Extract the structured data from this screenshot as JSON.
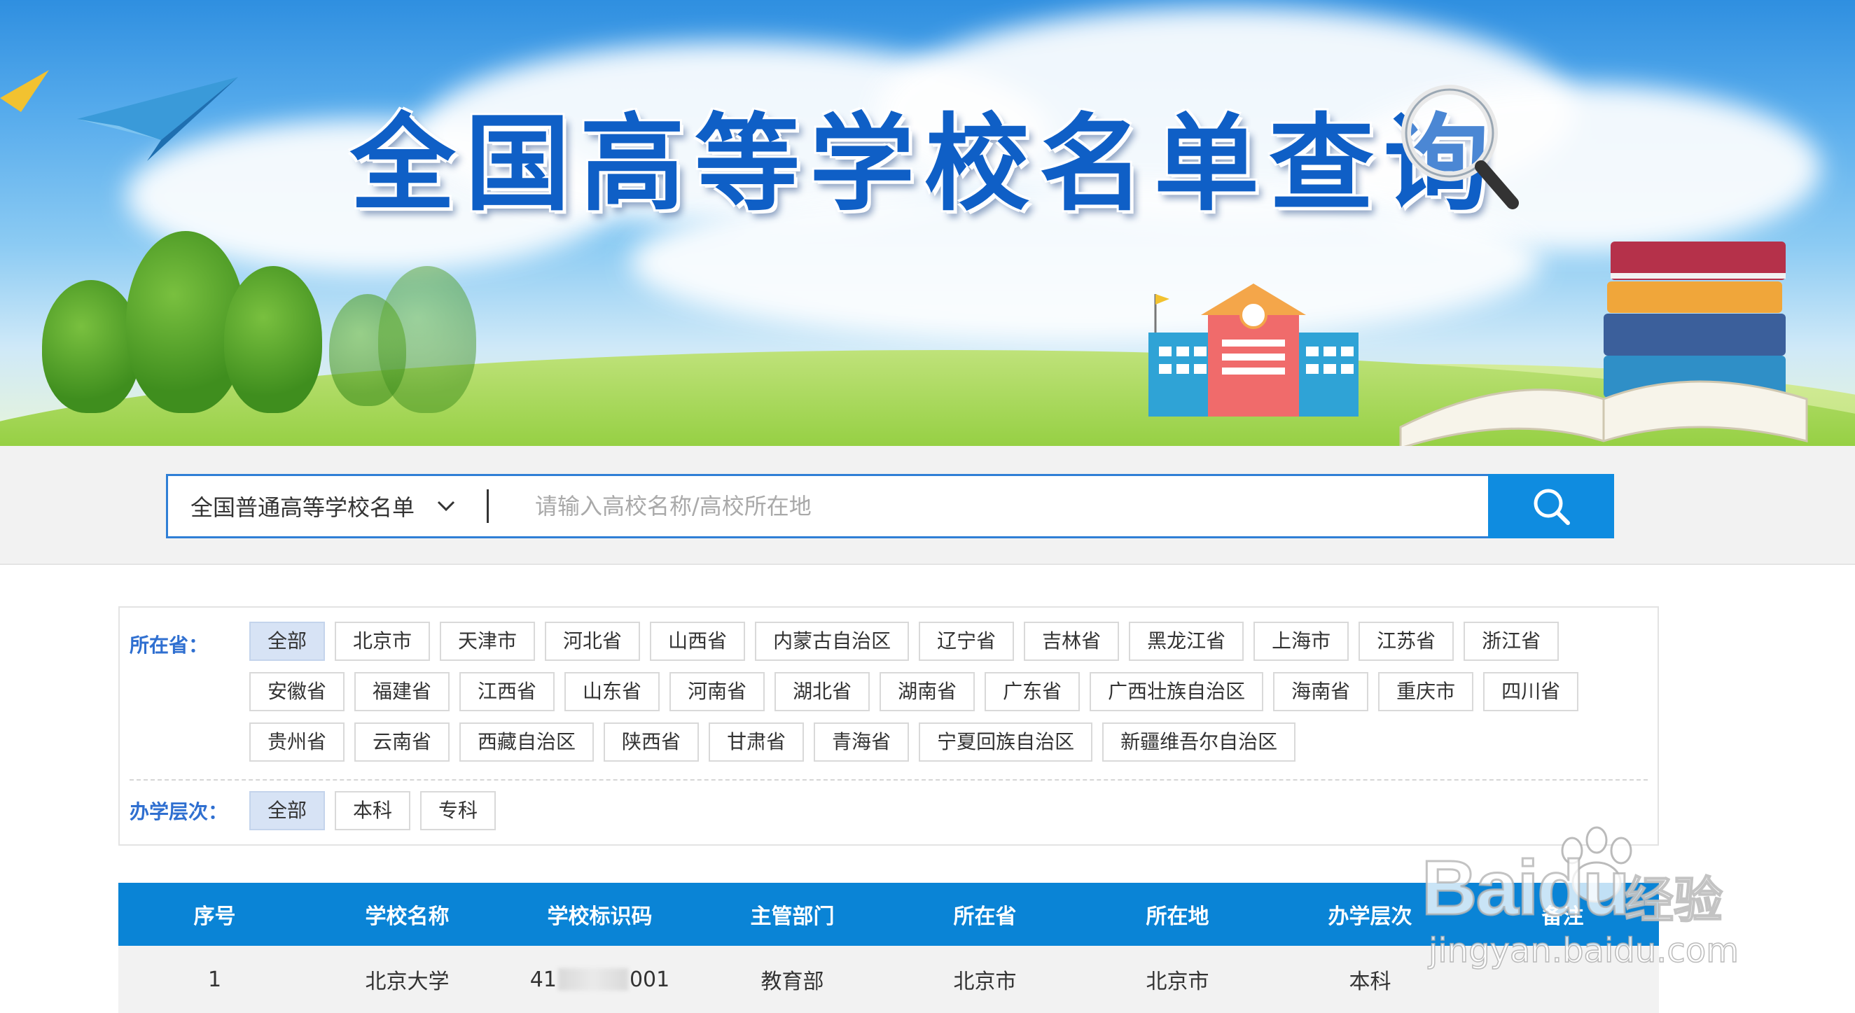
{
  "banner": {
    "title": "全国高等学校名单查询"
  },
  "search": {
    "select_label": "全国普通高等学校名单",
    "placeholder": "请输入高校名称/高校所在地",
    "search_icon": "search-icon"
  },
  "filters": {
    "province_label": "所在省：",
    "provinces": [
      "全部",
      "北京市",
      "天津市",
      "河北省",
      "山西省",
      "内蒙古自治区",
      "辽宁省",
      "吉林省",
      "黑龙江省",
      "上海市",
      "江苏省",
      "浙江省",
      "安徽省",
      "福建省",
      "江西省",
      "山东省",
      "河南省",
      "湖北省",
      "湖南省",
      "广东省",
      "广西壮族自治区",
      "海南省",
      "重庆市",
      "四川省",
      "贵州省",
      "云南省",
      "西藏自治区",
      "陕西省",
      "甘肃省",
      "青海省",
      "宁夏回族自治区",
      "新疆维吾尔自治区"
    ],
    "level_label": "办学层次：",
    "levels": [
      "全部",
      "本科",
      "专科"
    ],
    "active_province": "全部",
    "active_level": "全部"
  },
  "table": {
    "headers": [
      "序号",
      "学校名称",
      "学校标识码",
      "主管部门",
      "所在省",
      "所在地",
      "办学层次",
      "备注"
    ],
    "rows": [
      {
        "index": "1",
        "name": "北京大学",
        "code_prefix": "41",
        "code_suffix": "001",
        "dept": "教育部",
        "province": "北京市",
        "city": "北京市",
        "level": "本科",
        "note": ""
      }
    ]
  },
  "watermark": {
    "brand": "Bai",
    "brand2": "du",
    "cn": "经验",
    "url": "jingyan.baidu.com"
  },
  "colors": {
    "accent": "#0a84d6",
    "title": "#0f5fc6",
    "label": "#2f6fd0",
    "active_tag": "#d7e3f5"
  }
}
